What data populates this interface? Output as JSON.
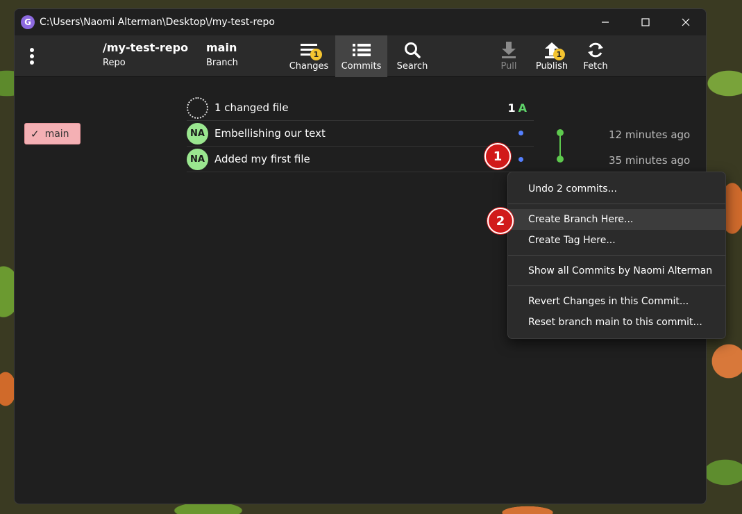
{
  "window": {
    "title": "C:\\Users\\Naomi Alterman\\Desktop\\/my-test-repo",
    "controls": [
      "minimize-icon",
      "maximize-icon",
      "close-icon"
    ]
  },
  "toolbar": {
    "repo": {
      "title": "/my-test-repo",
      "sub": "Repo"
    },
    "branch": {
      "title": "main",
      "sub": "Branch"
    },
    "buttons": [
      {
        "label": "Changes",
        "icon": "changes-icon",
        "badge": "1"
      },
      {
        "label": "Commits",
        "icon": "list-icon",
        "active": true
      },
      {
        "label": "Search",
        "icon": "search-icon"
      },
      {
        "label": "Pull",
        "icon": "download-icon",
        "disabled": true
      },
      {
        "label": "Publish",
        "icon": "upload-icon",
        "badge": "1"
      },
      {
        "label": "Fetch",
        "icon": "refresh-icon"
      }
    ]
  },
  "sidebar": {
    "branch_chip": {
      "check": "✓",
      "label": "main"
    }
  },
  "commits": [
    {
      "message": "1 changed file",
      "count": "1",
      "status_letter": "A"
    },
    {
      "avatar": "NA",
      "message": "Embellishing our text",
      "time": "12 minutes ago"
    },
    {
      "avatar": "NA",
      "message": "Added my first file",
      "time": "35 minutes ago"
    }
  ],
  "context_menu": {
    "items": [
      "Undo 2 commits...",
      "Create Branch Here...",
      "Create Tag Here...",
      "Show all Commits by Naomi Alterman",
      "Revert Changes in this Commit...",
      "Reset branch main to this commit..."
    ]
  },
  "callouts": [
    "1",
    "2"
  ],
  "colors": {
    "accent_badge": "#f4c430",
    "branch_chip": "#f4b0b4",
    "avatar": "#9ae68f",
    "graph": "#5ec94e",
    "added": "#5fd46a",
    "callout": "#d11a1a"
  }
}
